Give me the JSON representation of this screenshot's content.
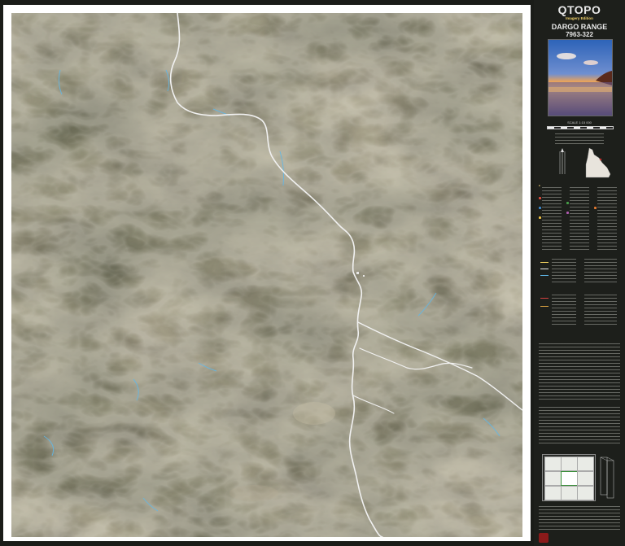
{
  "map_title": "QTOPO",
  "edition": "Imagery Edition",
  "sheet_name": "DARGO RANGE",
  "sheet_number": "7963-322",
  "scale": "SCALE 1:15 000",
  "colors": {
    "terrain_base": "#4a4a37",
    "contour": "#d8cfbc",
    "road": "#f1f1f1",
    "water": "#5fb7e8",
    "panel": "#1d1f1b",
    "accent": "#f2d36b"
  },
  "icons": {
    "north_arrow": "north-arrow-icon",
    "state_locator": "queensland-outline-icon",
    "crest": "queensland-crest-icon"
  }
}
